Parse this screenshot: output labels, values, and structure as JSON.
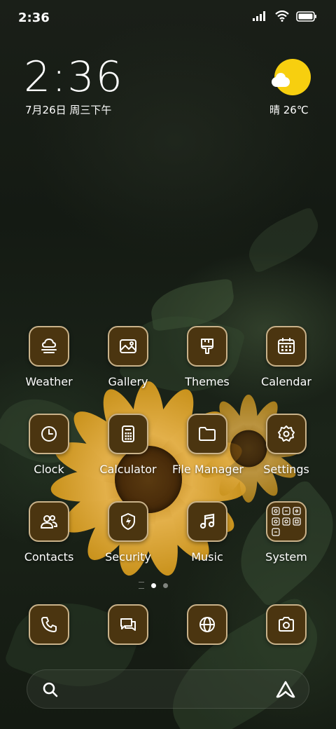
{
  "statusbar": {
    "time": "2:36"
  },
  "clock_widget": {
    "time": "2:36",
    "date": "7月26日 周三下午"
  },
  "weather_widget": {
    "text": "晴 26℃"
  },
  "apps": [
    {
      "label": "Weather",
      "icon": "weather-icon"
    },
    {
      "label": "Gallery",
      "icon": "gallery-icon"
    },
    {
      "label": "Themes",
      "icon": "themes-brush-icon"
    },
    {
      "label": "Calendar",
      "icon": "calendar-icon"
    },
    {
      "label": "Clock",
      "icon": "clock-icon"
    },
    {
      "label": "Calculator",
      "icon": "calculator-icon"
    },
    {
      "label": "File Manager",
      "icon": "folder-icon"
    },
    {
      "label": "Settings",
      "icon": "gear-icon"
    },
    {
      "label": "Contacts",
      "icon": "contacts-icon"
    },
    {
      "label": "Security",
      "icon": "security-shield-icon"
    },
    {
      "label": "Music",
      "icon": "music-note-icon"
    },
    {
      "label": "System",
      "icon": "folder-grid-icon"
    }
  ],
  "dock": [
    {
      "icon": "phone-icon"
    },
    {
      "icon": "messages-icon"
    },
    {
      "icon": "browser-globe-icon"
    },
    {
      "icon": "camera-icon"
    }
  ],
  "page_indicator": {
    "pages": 2,
    "current": 1
  },
  "colors": {
    "icon_bg": "#4b3510",
    "icon_border": "#c9b28a",
    "sun": "#f7cf0f"
  }
}
